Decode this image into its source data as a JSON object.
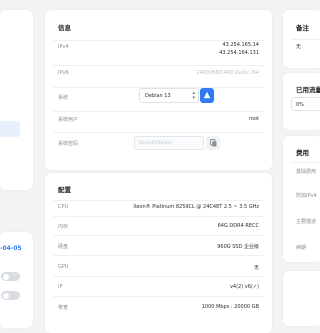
{
  "info": {
    "title": "信息",
    "ipv4_label": "IPv4",
    "ipv4_values": [
      "43.254.165.14",
      "43.254.164.131"
    ],
    "ipv6_label": "IPv6",
    "ipv6_value": "2400:f660:440:2e2e::/64",
    "os_label": "系统",
    "os_value": "Debian 13",
    "user_label": "系统用户",
    "user_value": "root",
    "password_label": "系统密码",
    "password_value": "8bd3d5f8d3ed"
  },
  "config": {
    "title": "配置",
    "rows": [
      {
        "label": "CPU",
        "value": "Xeon® Platinum 8259CL @ 24C48T 2.5 ~ 3.5 GHz"
      },
      {
        "label": "内存",
        "value": "64G DDR4 RECC"
      },
      {
        "label": "硬盘",
        "value": "960G SSD 企业级"
      },
      {
        "label": "GPU",
        "value": "无"
      },
      {
        "label": "IP",
        "value": "v4(2) v6(✓)"
      },
      {
        "label": "带宽",
        "value": "1000 Mbps : 20000 GB"
      }
    ]
  },
  "left": {
    "date_text": "-04-05"
  },
  "notes": {
    "title": "备注",
    "value": "无"
  },
  "traffic": {
    "title": "已用流量",
    "value": "0%"
  },
  "fees": {
    "title": "费用",
    "items": [
      "基础费用",
      "附加IPv4",
      "主要描述",
      "续期"
    ]
  },
  "colors": {
    "accent": "#2f7bf5",
    "background": "#f2f3f5",
    "card": "#ffffff"
  }
}
